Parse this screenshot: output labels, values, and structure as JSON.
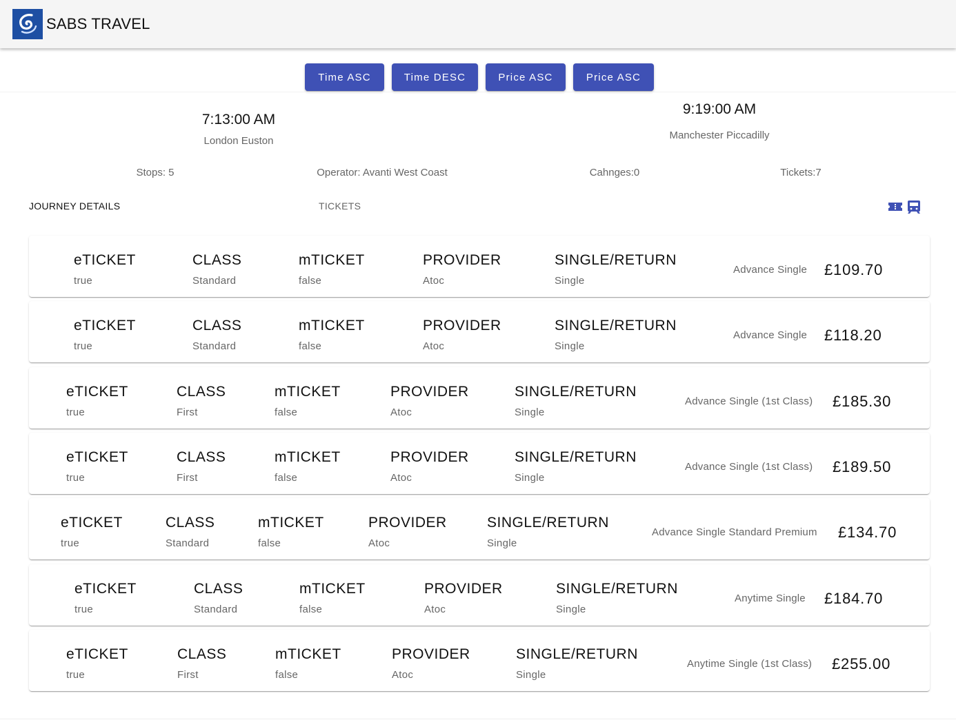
{
  "app": {
    "brand": "SABS TRAVEL"
  },
  "sort_buttons": [
    "Time ASC",
    "Time DESC",
    "Price ASC",
    "Price ASC"
  ],
  "journey": {
    "departure_time": "7:13:00 AM",
    "departure_station": "London Euston",
    "arrival_time": "9:19:00 AM",
    "arrival_station": "Manchester Piccadilly",
    "stops": "Stops: 5",
    "operator": "Operator: Avanti West Coast",
    "changes": "Cahnges:0",
    "tickets_count": "Tickets:7"
  },
  "tabs": {
    "journey_details": "JOURNEY DETAILS",
    "tickets": "TICKETS"
  },
  "tab_icons": [
    "ticket-icon",
    "train-icon"
  ],
  "accent_color": "#3f51b5",
  "ticket_headers": {
    "eticket": "eTICKET",
    "class": "CLASS",
    "mticket": "mTICKET",
    "provider": "PROVIDER",
    "single_return": "SINGLE/RETURN"
  },
  "tickets": [
    {
      "eticket": "true",
      "class": "Standard",
      "mticket": "false",
      "provider": "Atoc",
      "single_return": "Single",
      "fare": "Advance Single",
      "price": "£109.70"
    },
    {
      "eticket": "true",
      "class": "Standard",
      "mticket": "false",
      "provider": "Atoc",
      "single_return": "Single",
      "fare": "Advance Single",
      "price": "£118.20"
    },
    {
      "eticket": "true",
      "class": "First",
      "mticket": "false",
      "provider": "Atoc",
      "single_return": "Single",
      "fare": "Advance Single (1st Class)",
      "price": "£185.30"
    },
    {
      "eticket": "true",
      "class": "First",
      "mticket": "false",
      "provider": "Atoc",
      "single_return": "Single",
      "fare": "Advance Single (1st Class)",
      "price": "£189.50"
    },
    {
      "eticket": "true",
      "class": "Standard",
      "mticket": "false",
      "provider": "Atoc",
      "single_return": "Single",
      "fare": "Advance Single Standard Premium",
      "price": "£134.70"
    },
    {
      "eticket": "true",
      "class": "Standard",
      "mticket": "false",
      "provider": "Atoc",
      "single_return": "Single",
      "fare": "Anytime Single",
      "price": "£184.70"
    },
    {
      "eticket": "true",
      "class": "First",
      "mticket": "false",
      "provider": "Atoc",
      "single_return": "Single",
      "fare": "Anytime Single (1st Class)",
      "price": "£255.00"
    }
  ]
}
